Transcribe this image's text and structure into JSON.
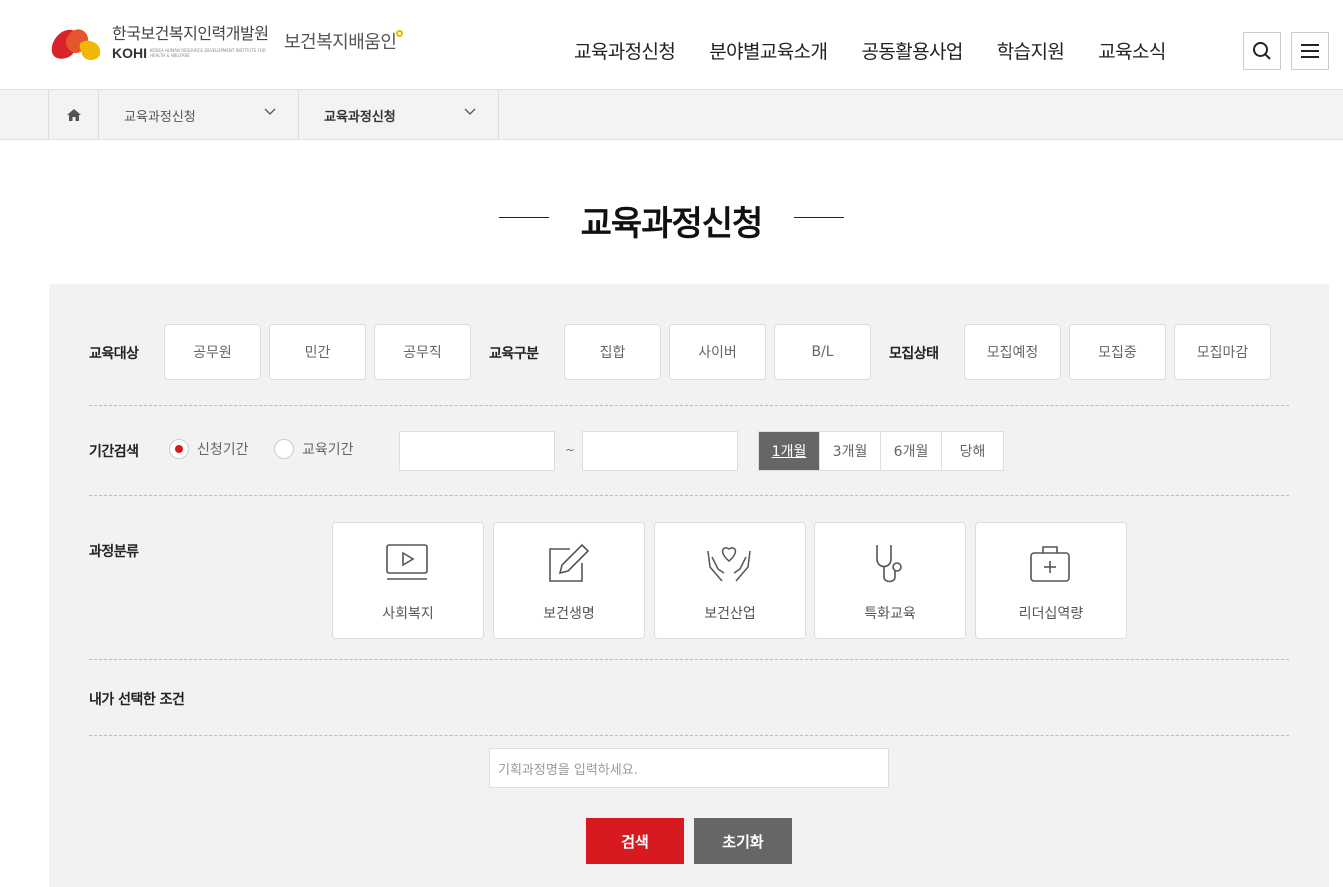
{
  "header": {
    "logo_ko": "한국보건복지인력개발원",
    "logo_en": "KOHI",
    "logo_en_sub": "KOREA HUMAN RESOURCE DEVELOPMENT INSTITUTE FOR HEALTH & WELFARE",
    "logo_sub": "보건복지배움인",
    "nav": [
      "교육과정신청",
      "분야별교육소개",
      "공동활용사업",
      "학습지원",
      "교육소식"
    ],
    "search_icon": "search-icon",
    "menu_icon": "hamburger-menu-icon"
  },
  "breadcrumb": {
    "home_icon": "home-icon",
    "level1": "교육과정신청",
    "level2": "교육과정신청"
  },
  "page": {
    "title": "교육과정신청"
  },
  "filters": {
    "target_label": "교육대상",
    "target_options": [
      "공무원",
      "민간",
      "공무직"
    ],
    "type_label": "교육구분",
    "type_options": [
      "집합",
      "사이버",
      "B/L"
    ],
    "status_label": "모집상태",
    "status_options": [
      "모집예정",
      "모집중",
      "모집마감"
    ],
    "period_label": "기간검색",
    "period_radio": [
      {
        "label": "신청기간",
        "checked": true
      },
      {
        "label": "교육기간",
        "checked": false
      }
    ],
    "date_start": "",
    "date_end": "",
    "tilde": "~",
    "period_buttons": [
      "1개월",
      "3개월",
      "6개월",
      "당해"
    ],
    "period_active": "1개월",
    "category_label": "과정분류",
    "categories": [
      {
        "label": "사회복지",
        "icon": "video-play-icon"
      },
      {
        "label": "보건생명",
        "icon": "edit-pencil-icon"
      },
      {
        "label": "보건산업",
        "icon": "hands-heart-icon"
      },
      {
        "label": "특화교육",
        "icon": "stethoscope-icon"
      },
      {
        "label": "리더십역량",
        "icon": "first-aid-kit-icon"
      }
    ],
    "selected_label": "내가 선택한 조건",
    "search_placeholder": "기획과정명을 입력하세요.",
    "search_button": "검색",
    "reset_button": "초기화"
  },
  "colors": {
    "accent_red": "#d71920",
    "reset_gray": "#666666",
    "panel_bg": "#f2f2f3"
  }
}
